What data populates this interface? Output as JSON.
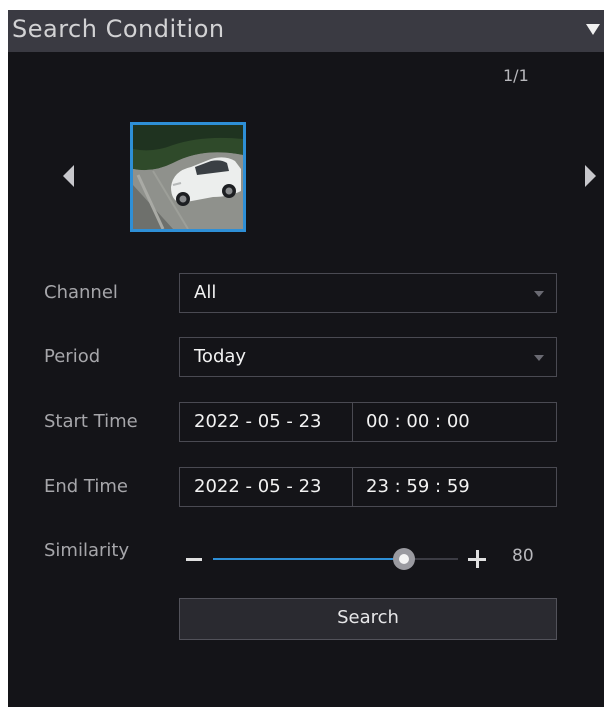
{
  "header": {
    "title": "Search Condition",
    "collapse_icon": "triangle-down-icon"
  },
  "gallery": {
    "page_indicator": "1/1",
    "prev_icon": "triangle-left-icon",
    "next_icon": "triangle-right-icon",
    "thumbnail": "white sedan car on road",
    "thumbnail_border_color": "#2e8fd6"
  },
  "form": {
    "channel": {
      "label": "Channel",
      "value": "All"
    },
    "period": {
      "label": "Period",
      "value": "Today"
    },
    "start_time": {
      "label": "Start Time",
      "date": "2022 - 05 - 23",
      "time": "00 : 00 : 00"
    },
    "end_time": {
      "label": "End Time",
      "date": "2022 - 05 - 23",
      "time": "23 : 59 : 59"
    },
    "similarity": {
      "label": "Similarity",
      "value": 80,
      "value_text": "80",
      "fraction": 0.78,
      "accent": "#2e8fd6"
    }
  },
  "search_button": {
    "label": "Search"
  }
}
